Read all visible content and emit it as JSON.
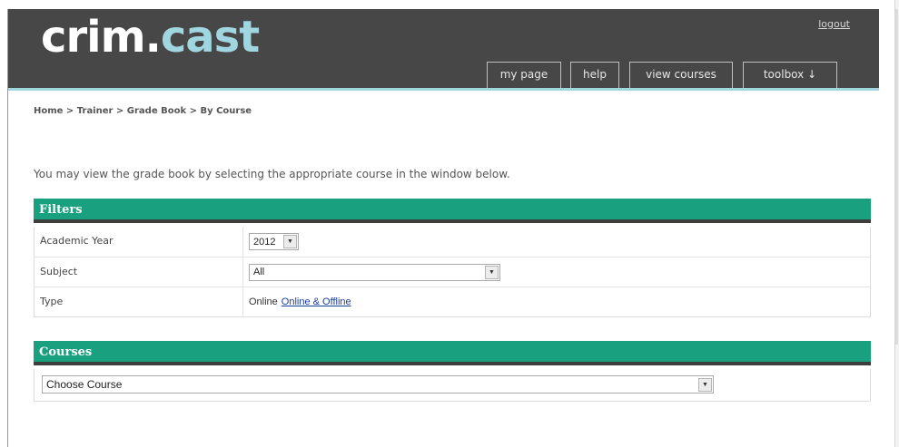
{
  "app": {
    "logo_part1": "crim.",
    "logo_part2": "cast",
    "logout_label": "logout"
  },
  "nav": {
    "items": [
      {
        "label": "my page"
      },
      {
        "label": "help"
      },
      {
        "label": "view courses"
      },
      {
        "label": "toolbox ↓"
      }
    ]
  },
  "breadcrumb": "Home > Trainer > Grade Book > By Course",
  "intro": "You may view the grade book by selecting the appropriate course in the window below.",
  "filters": {
    "title": "Filters",
    "academic_year": {
      "label": "Academic Year",
      "value": "2012"
    },
    "subject": {
      "label": "Subject",
      "value": "All"
    },
    "type": {
      "label": "Type",
      "current": "Online",
      "link": "Online & Offline"
    }
  },
  "courses": {
    "title": "Courses",
    "select_value": "Choose Course"
  },
  "colors": {
    "header_bg": "#474747",
    "accent": "#9fd6df",
    "panel_header": "#19a17f",
    "link": "#1a3c9c"
  },
  "icons": {
    "dropdown": "chevron-down-icon"
  }
}
